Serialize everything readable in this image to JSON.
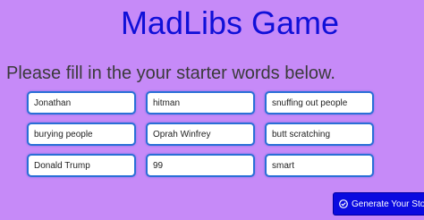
{
  "header": {
    "title": "MadLibs Game"
  },
  "instructions": "Please fill in the your starter words below.",
  "fields": [
    {
      "value": "Jonathan"
    },
    {
      "value": "hitman"
    },
    {
      "value": "snuffing out people"
    },
    {
      "value": "burying people"
    },
    {
      "value": "Oprah Winfrey"
    },
    {
      "value": "butt scratching"
    },
    {
      "value": "Donald Trump"
    },
    {
      "value": "99"
    },
    {
      "value": "smart"
    }
  ],
  "generate_button": {
    "label": "Generate Your Story",
    "icon": "check-circle-icon"
  },
  "colors": {
    "background": "#c68af8",
    "title": "#1010d8",
    "button": "#0a0ae0",
    "field_border": "#2a6fd6"
  }
}
